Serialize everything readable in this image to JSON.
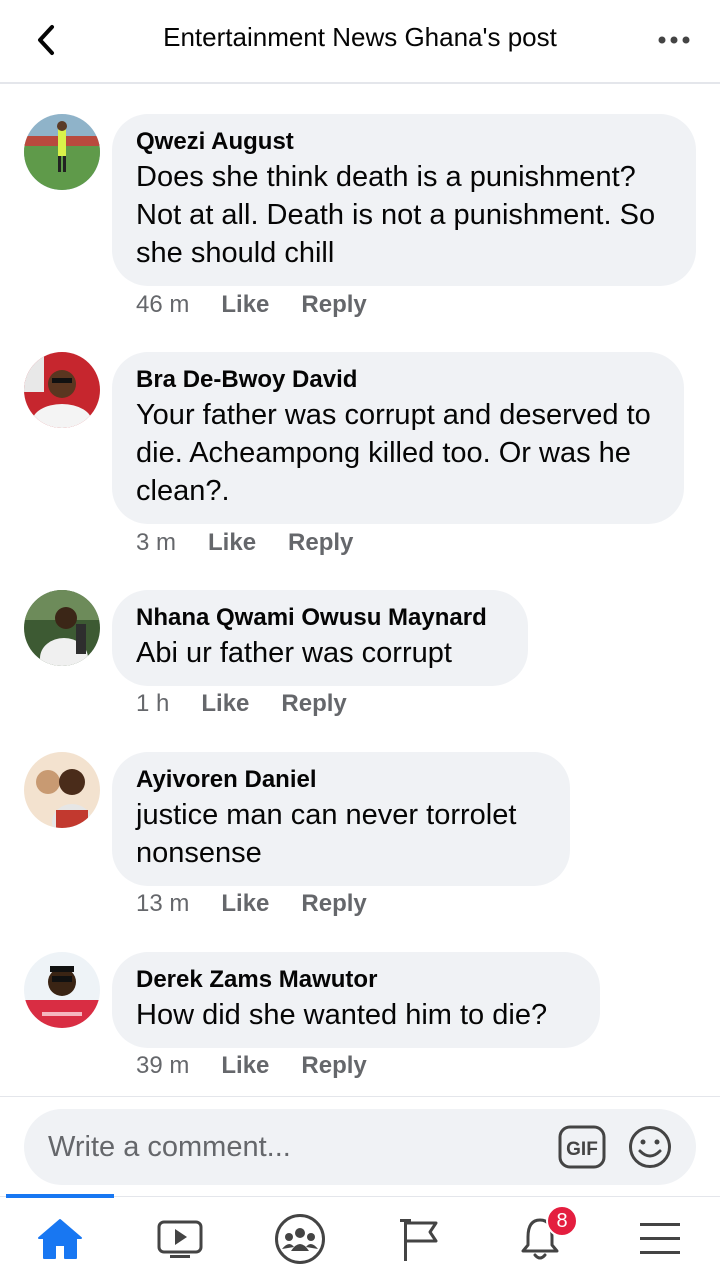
{
  "header": {
    "title": "Entertainment News Ghana's post",
    "back_icon": "chevron-left-icon",
    "more_icon": "more-horizontal-icon"
  },
  "comments": [
    {
      "author": "Qwezi August",
      "text": "Does she think death is a punishment? Not at all. Death is not a punishment. So she should chill",
      "time": "46 m",
      "like_label": "Like",
      "reply_label": "Reply"
    },
    {
      "author": "Bra De-Bwoy David",
      "text": "Your father was corrupt and deserved to die. Acheampong killed too. Or was he clean?.",
      "time": "3 m",
      "like_label": "Like",
      "reply_label": "Reply"
    },
    {
      "author": "Nhana Qwami Owusu Maynard",
      "text": "Abi ur father was corrupt",
      "time": "1 h",
      "like_label": "Like",
      "reply_label": "Reply"
    },
    {
      "author": "Ayivoren Daniel",
      "text": "justice man can never torrolet nonsense",
      "time": "13 m",
      "like_label": "Like",
      "reply_label": "Reply"
    },
    {
      "author": "Derek Zams Mawutor",
      "text": "How did she wanted him to die?",
      "time": "39 m",
      "like_label": "Like",
      "reply_label": "Reply"
    }
  ],
  "composer": {
    "placeholder": "Write a comment...",
    "gif_label": "GIF",
    "emoji_icon": "smiley-icon"
  },
  "tabbar": {
    "tabs": [
      {
        "icon": "home-icon",
        "active": true
      },
      {
        "icon": "video-icon",
        "active": false
      },
      {
        "icon": "groups-icon",
        "active": false
      },
      {
        "icon": "pages-flag-icon",
        "active": false
      },
      {
        "icon": "bell-icon",
        "active": false
      },
      {
        "icon": "menu-icon",
        "active": false
      }
    ],
    "notification_count": "8"
  },
  "colors": {
    "accent": "#1877f2",
    "bubble": "#f0f2f5",
    "secondary_text": "#65676b",
    "badge": "#e41e3f"
  }
}
